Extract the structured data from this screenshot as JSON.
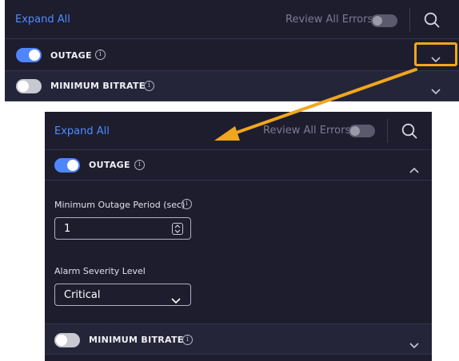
{
  "collapsed": {
    "toolbar": {
      "expand_all": "Expand All",
      "review_all_errors": "Review All Errors"
    },
    "sections": [
      {
        "title": "OUTAGE",
        "enabled": true
      },
      {
        "title": "MINIMUM BITRATE",
        "enabled": false
      }
    ]
  },
  "expanded": {
    "toolbar": {
      "expand_all": "Expand All",
      "review_all_errors": "Review All Errors"
    },
    "outage": {
      "title": "OUTAGE",
      "enabled": true,
      "min_period_label": "Minimum Outage Period (sec)",
      "min_period_value": "1",
      "severity_label": "Alarm Severity Level",
      "severity_value": "Critical"
    },
    "minbitrate": {
      "title": "MINIMUM BITRATE",
      "enabled": false
    }
  },
  "colors": {
    "panel_bg": "#1d1d2e",
    "accent": "#4f8cff",
    "callout": "#f0a71c"
  },
  "icons": {
    "search": "search-icon",
    "info": "info-icon",
    "chevron_down": "chevron-down-icon",
    "chevron_up": "chevron-up-icon",
    "stepper": "stepper-icon"
  }
}
